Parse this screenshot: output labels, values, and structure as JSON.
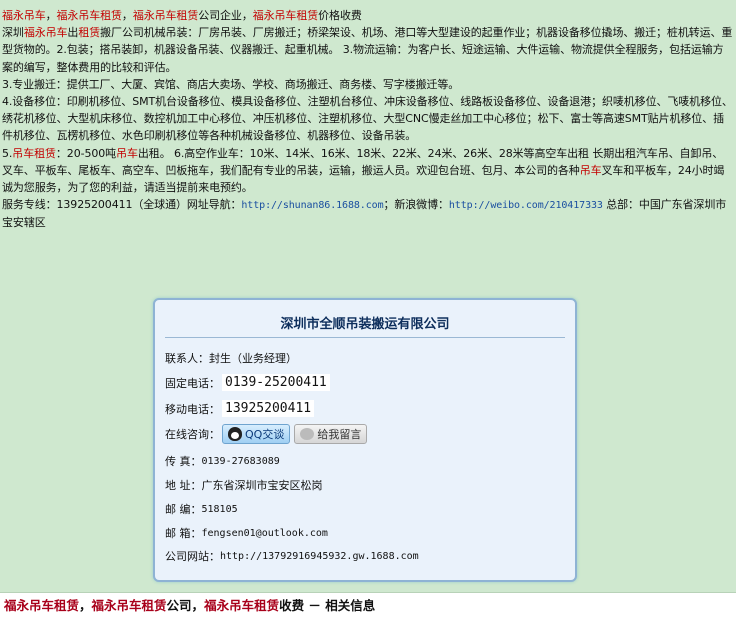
{
  "intro": {
    "l1": [
      "福永吊车",
      "，",
      "福永吊车租赁",
      "，",
      "福永吊车租赁",
      "公司企业，",
      "福永吊车租赁",
      "价格收费"
    ],
    "l2a": "深圳",
    "l2b": "福永吊车",
    "l2c": "出",
    "l2d": "租赁",
    "l2e": "搬厂公司机械吊装：厂房吊装、厂房搬迁；桥梁架设、机场、港口等大型建设的起重作业；机器设备移位撬场、搬迁；桩机转运、重型货物的。2.包装；搭吊装卸，机器设备吊装、仪器搬迁、起重机械。 3.物流运输：为客户长、短途运输、大件运输、物流提供全程服务，包括运输方案的编写，整体费用的比较和评估。",
    "l3": "3.专业搬迁：提供工厂、大厦、宾馆、商店大卖场、学校、商场搬迁、商务楼、写字楼搬迁等。",
    "l4": "4.设备移位：印刷机移位、SMT机台设备移位、模具设备移位、注塑机台移位、冲床设备移位、线路板设备移位、设备退港；织唛机移位、飞唛机移位、绣花机移位、大型机床移位、数控机加工中心移位、冲压机移位、注塑机移位、大型CNC慢走丝加工中心移位；松下、富士等高速SMT贴片机移位、插件机移位、瓦楞机移位、水色印刷机移位等各种机械设备移位、机器移位、设备吊装。",
    "l5a": "5.",
    "l5b": "吊车租赁",
    "l5c": "：20-500吨",
    "l5d": "吊车",
    "l5e": "出租。 6.高空作业车：10米、14米、16米、18米、22米、24米、26米、28米等高空车出租 长期出租汽车吊、自卸吊、叉车、平板车、尾板车、高空车、凹板拖车，我们配有专业的吊装，运输，搬运人员。欢迎包台班、包月、本公司的各种",
    "l5f": "吊车",
    "l5g": "叉车和平板车，24小时竭诚为您服务，为了您的利益，请适当提前来电预约。",
    "l6a": "服务专线：13925200411（全球通）网址导航：",
    "l6link1": "http://shunan86.1688.com",
    "l6b": "；新浪微博：",
    "l6link2": "http://weibo.com/210417333",
    "l6c": "  总部：中国广东省深圳市宝安辖区"
  },
  "card": {
    "title": "深圳市全顺吊装搬运有限公司",
    "contact_label": "联系人：",
    "contact_value": "封生（业务经理）",
    "phone_label": "固定电话：",
    "phone_value": "0139-25200411",
    "mobile_label": "移动电话：",
    "mobile_value": "13925200411",
    "online_label": "在线咨询：",
    "qq_button": "QQ交谈",
    "msg_button": "给我留言",
    "fax_label": "传 真：",
    "fax_value": "0139-27683089",
    "addr_label": "地 址：",
    "addr_value": "广东省深圳市宝安区松岗",
    "zip_label": "邮 编：",
    "zip_value": "518105",
    "email_label": "邮 箱：",
    "email_value": "fengsen01@outlook.com",
    "site_label": "公司网站：",
    "site_value": "http://13792916945932.gw.1688.com"
  },
  "footer": {
    "p1": "福永吊车租赁",
    "p2": "，",
    "p3": "福永吊车租赁",
    "p4": "公司，",
    "p5": "福永吊车租赁",
    "p6": "收费 － 相关信息"
  }
}
